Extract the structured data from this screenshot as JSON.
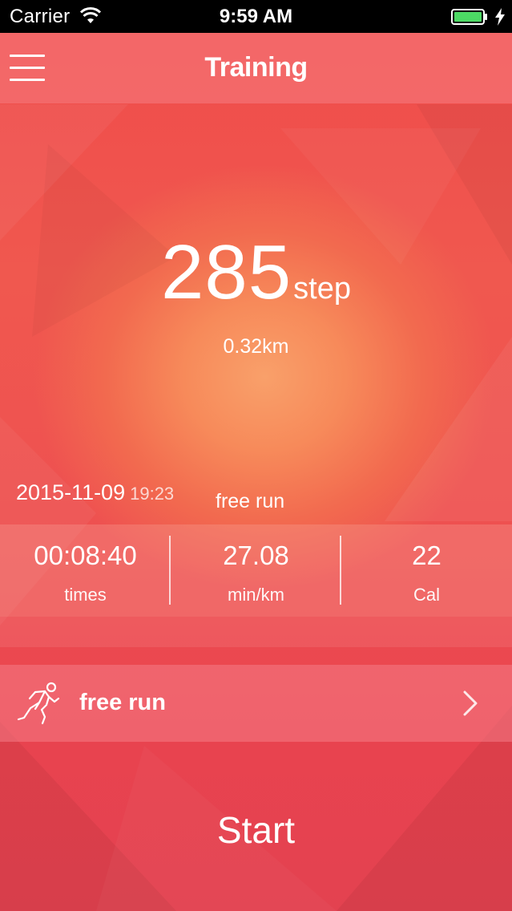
{
  "status_bar": {
    "carrier": "Carrier",
    "time": "9:59 AM",
    "wifi_icon": "wifi-icon",
    "battery_icon": "battery-icon",
    "charging_icon": "bolt-icon",
    "battery_color": "#4cd964"
  },
  "header": {
    "title": "Training",
    "menu_icon": "hamburger-menu-icon"
  },
  "summary": {
    "steps": "285",
    "steps_unit": "step",
    "distance": "0.32km"
  },
  "session": {
    "date": "2015-11-09",
    "time": "19:23",
    "mode": "free run"
  },
  "stats": [
    {
      "value": "00:08:40",
      "label": "times"
    },
    {
      "value": "27.08",
      "label": "min/km"
    },
    {
      "value": "22",
      "label": "Cal"
    }
  ],
  "mode_selector": {
    "icon": "runner-icon",
    "label": "free run",
    "chevron": "chevron-right-icon"
  },
  "start_label": "Start",
  "colors": {
    "background_top": "#ef4a4a",
    "background_glow": "#f9a06a",
    "text": "#ffffff"
  }
}
